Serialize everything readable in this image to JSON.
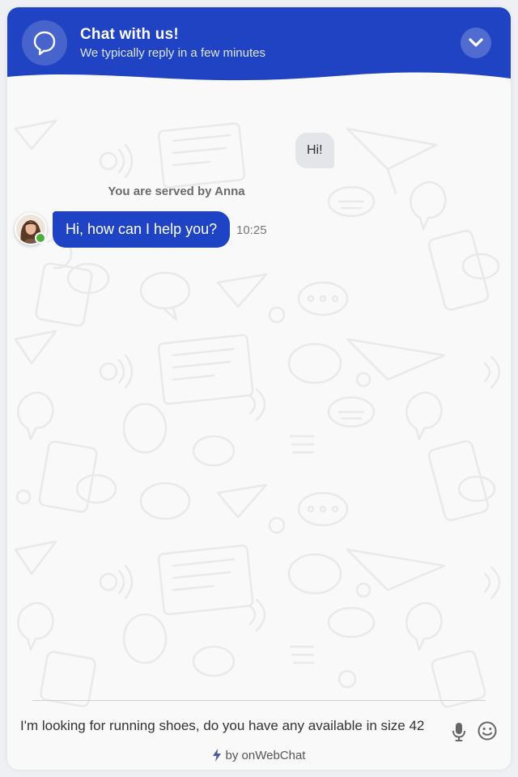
{
  "header": {
    "title": "Chat with us!",
    "subtitle": "We typically reply in a few minutes",
    "icon": "chat-bubble-icon",
    "collapse_icon": "chevron-down-icon",
    "color": "#1f43c3"
  },
  "conversation": {
    "user_message": "Hi!",
    "served_by_prefix": "You are served by",
    "agent_name": "Anna",
    "agent_message": "Hi, how can I help you?",
    "agent_message_time": "10:25",
    "agent_status": "online"
  },
  "composer": {
    "value": "I'm looking for running shoes, do you have any available in size 42",
    "mic_icon": "microphone-icon",
    "emoji_icon": "emoji-icon"
  },
  "footer": {
    "powered_by": "by onWebChat",
    "icon": "lightning-icon"
  }
}
